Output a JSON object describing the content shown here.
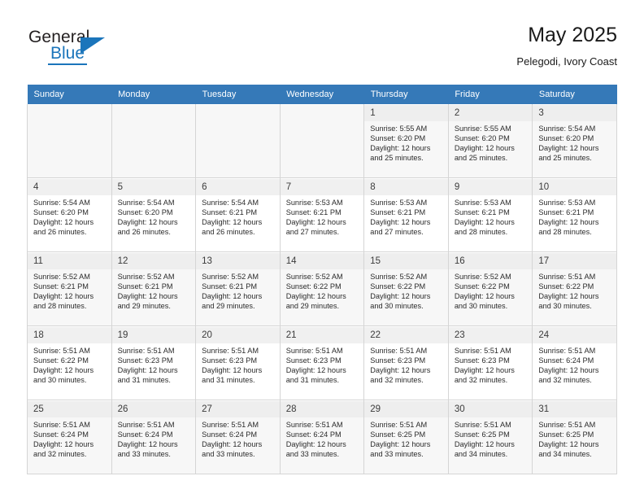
{
  "brand": {
    "line1": "General",
    "line2": "Blue",
    "accent_color": "#1b75bb",
    "logo_icon": "triangle-flag-icon"
  },
  "header": {
    "title": "May 2025",
    "subtitle": "Pelegodi, Ivory Coast"
  },
  "calendar": {
    "header_background": "#3579b8",
    "weekday_headers": [
      "Sunday",
      "Monday",
      "Tuesday",
      "Wednesday",
      "Thursday",
      "Friday",
      "Saturday"
    ],
    "weeks": [
      [
        {
          "day": "",
          "sunrise": "",
          "sunset": "",
          "daylight1": "",
          "daylight2": ""
        },
        {
          "day": "",
          "sunrise": "",
          "sunset": "",
          "daylight1": "",
          "daylight2": ""
        },
        {
          "day": "",
          "sunrise": "",
          "sunset": "",
          "daylight1": "",
          "daylight2": ""
        },
        {
          "day": "",
          "sunrise": "",
          "sunset": "",
          "daylight1": "",
          "daylight2": ""
        },
        {
          "day": "1",
          "sunrise": "Sunrise: 5:55 AM",
          "sunset": "Sunset: 6:20 PM",
          "daylight1": "Daylight: 12 hours",
          "daylight2": "and 25 minutes."
        },
        {
          "day": "2",
          "sunrise": "Sunrise: 5:55 AM",
          "sunset": "Sunset: 6:20 PM",
          "daylight1": "Daylight: 12 hours",
          "daylight2": "and 25 minutes."
        },
        {
          "day": "3",
          "sunrise": "Sunrise: 5:54 AM",
          "sunset": "Sunset: 6:20 PM",
          "daylight1": "Daylight: 12 hours",
          "daylight2": "and 25 minutes."
        }
      ],
      [
        {
          "day": "4",
          "sunrise": "Sunrise: 5:54 AM",
          "sunset": "Sunset: 6:20 PM",
          "daylight1": "Daylight: 12 hours",
          "daylight2": "and 26 minutes."
        },
        {
          "day": "5",
          "sunrise": "Sunrise: 5:54 AM",
          "sunset": "Sunset: 6:20 PM",
          "daylight1": "Daylight: 12 hours",
          "daylight2": "and 26 minutes."
        },
        {
          "day": "6",
          "sunrise": "Sunrise: 5:54 AM",
          "sunset": "Sunset: 6:21 PM",
          "daylight1": "Daylight: 12 hours",
          "daylight2": "and 26 minutes."
        },
        {
          "day": "7",
          "sunrise": "Sunrise: 5:53 AM",
          "sunset": "Sunset: 6:21 PM",
          "daylight1": "Daylight: 12 hours",
          "daylight2": "and 27 minutes."
        },
        {
          "day": "8",
          "sunrise": "Sunrise: 5:53 AM",
          "sunset": "Sunset: 6:21 PM",
          "daylight1": "Daylight: 12 hours",
          "daylight2": "and 27 minutes."
        },
        {
          "day": "9",
          "sunrise": "Sunrise: 5:53 AM",
          "sunset": "Sunset: 6:21 PM",
          "daylight1": "Daylight: 12 hours",
          "daylight2": "and 28 minutes."
        },
        {
          "day": "10",
          "sunrise": "Sunrise: 5:53 AM",
          "sunset": "Sunset: 6:21 PM",
          "daylight1": "Daylight: 12 hours",
          "daylight2": "and 28 minutes."
        }
      ],
      [
        {
          "day": "11",
          "sunrise": "Sunrise: 5:52 AM",
          "sunset": "Sunset: 6:21 PM",
          "daylight1": "Daylight: 12 hours",
          "daylight2": "and 28 minutes."
        },
        {
          "day": "12",
          "sunrise": "Sunrise: 5:52 AM",
          "sunset": "Sunset: 6:21 PM",
          "daylight1": "Daylight: 12 hours",
          "daylight2": "and 29 minutes."
        },
        {
          "day": "13",
          "sunrise": "Sunrise: 5:52 AM",
          "sunset": "Sunset: 6:21 PM",
          "daylight1": "Daylight: 12 hours",
          "daylight2": "and 29 minutes."
        },
        {
          "day": "14",
          "sunrise": "Sunrise: 5:52 AM",
          "sunset": "Sunset: 6:22 PM",
          "daylight1": "Daylight: 12 hours",
          "daylight2": "and 29 minutes."
        },
        {
          "day": "15",
          "sunrise": "Sunrise: 5:52 AM",
          "sunset": "Sunset: 6:22 PM",
          "daylight1": "Daylight: 12 hours",
          "daylight2": "and 30 minutes."
        },
        {
          "day": "16",
          "sunrise": "Sunrise: 5:52 AM",
          "sunset": "Sunset: 6:22 PM",
          "daylight1": "Daylight: 12 hours",
          "daylight2": "and 30 minutes."
        },
        {
          "day": "17",
          "sunrise": "Sunrise: 5:51 AM",
          "sunset": "Sunset: 6:22 PM",
          "daylight1": "Daylight: 12 hours",
          "daylight2": "and 30 minutes."
        }
      ],
      [
        {
          "day": "18",
          "sunrise": "Sunrise: 5:51 AM",
          "sunset": "Sunset: 6:22 PM",
          "daylight1": "Daylight: 12 hours",
          "daylight2": "and 30 minutes."
        },
        {
          "day": "19",
          "sunrise": "Sunrise: 5:51 AM",
          "sunset": "Sunset: 6:23 PM",
          "daylight1": "Daylight: 12 hours",
          "daylight2": "and 31 minutes."
        },
        {
          "day": "20",
          "sunrise": "Sunrise: 5:51 AM",
          "sunset": "Sunset: 6:23 PM",
          "daylight1": "Daylight: 12 hours",
          "daylight2": "and 31 minutes."
        },
        {
          "day": "21",
          "sunrise": "Sunrise: 5:51 AM",
          "sunset": "Sunset: 6:23 PM",
          "daylight1": "Daylight: 12 hours",
          "daylight2": "and 31 minutes."
        },
        {
          "day": "22",
          "sunrise": "Sunrise: 5:51 AM",
          "sunset": "Sunset: 6:23 PM",
          "daylight1": "Daylight: 12 hours",
          "daylight2": "and 32 minutes."
        },
        {
          "day": "23",
          "sunrise": "Sunrise: 5:51 AM",
          "sunset": "Sunset: 6:23 PM",
          "daylight1": "Daylight: 12 hours",
          "daylight2": "and 32 minutes."
        },
        {
          "day": "24",
          "sunrise": "Sunrise: 5:51 AM",
          "sunset": "Sunset: 6:24 PM",
          "daylight1": "Daylight: 12 hours",
          "daylight2": "and 32 minutes."
        }
      ],
      [
        {
          "day": "25",
          "sunrise": "Sunrise: 5:51 AM",
          "sunset": "Sunset: 6:24 PM",
          "daylight1": "Daylight: 12 hours",
          "daylight2": "and 32 minutes."
        },
        {
          "day": "26",
          "sunrise": "Sunrise: 5:51 AM",
          "sunset": "Sunset: 6:24 PM",
          "daylight1": "Daylight: 12 hours",
          "daylight2": "and 33 minutes."
        },
        {
          "day": "27",
          "sunrise": "Sunrise: 5:51 AM",
          "sunset": "Sunset: 6:24 PM",
          "daylight1": "Daylight: 12 hours",
          "daylight2": "and 33 minutes."
        },
        {
          "day": "28",
          "sunrise": "Sunrise: 5:51 AM",
          "sunset": "Sunset: 6:24 PM",
          "daylight1": "Daylight: 12 hours",
          "daylight2": "and 33 minutes."
        },
        {
          "day": "29",
          "sunrise": "Sunrise: 5:51 AM",
          "sunset": "Sunset: 6:25 PM",
          "daylight1": "Daylight: 12 hours",
          "daylight2": "and 33 minutes."
        },
        {
          "day": "30",
          "sunrise": "Sunrise: 5:51 AM",
          "sunset": "Sunset: 6:25 PM",
          "daylight1": "Daylight: 12 hours",
          "daylight2": "and 34 minutes."
        },
        {
          "day": "31",
          "sunrise": "Sunrise: 5:51 AM",
          "sunset": "Sunset: 6:25 PM",
          "daylight1": "Daylight: 12 hours",
          "daylight2": "and 34 minutes."
        }
      ]
    ]
  }
}
